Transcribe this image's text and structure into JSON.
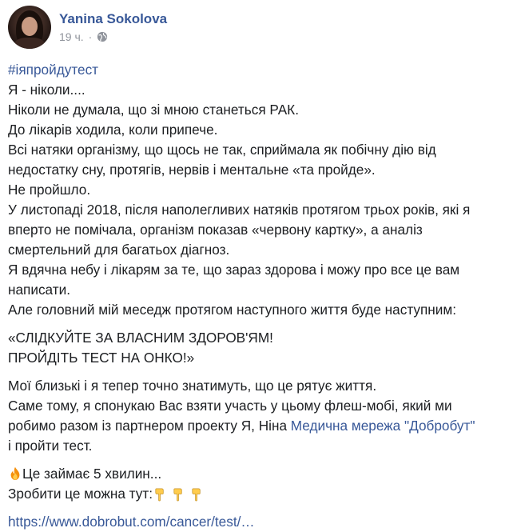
{
  "post": {
    "author": "Yanina Sokolova",
    "time": "19 ч.",
    "separator": "·",
    "hashtag": "#іяпройдутест",
    "lines1": [
      "Я - ніколи....",
      "Ніколи не думала, що зі мною станеться РАК.",
      "До лікарів ходила, коли припече.",
      "Всі натяки організму, що щось не так, сприймала як побічну дію від",
      "недостатку сну, протягів, нервів і ментальне «та пройде».",
      "Не пройшло.",
      "У листопаді 2018, після наполегливих натяків протягом трьох років, які я",
      "вперто не помічала, організм показав «червону картку», а аналіз",
      "смертельний для багатьох діагноз.",
      "Я вдячна небу і лікарям за те, що зараз здорова і можу про все це вам",
      "написати.",
      "Але головний мій меседж протягом наступного життя буде наступним:"
    ],
    "quote": [
      "«СЛІДКУЙТЕ ЗА ВЛАСНИМ ЗДОРОВ'ЯМ!",
      "ПРОЙДІТЬ ТЕСТ НА ОНКО!»"
    ],
    "lines2": [
      "Мої близькі і я тепер точно знатимуть, що це рятує життя.",
      "Саме тому, я спонукаю Вас взяти участь у цьому флеш-мобі, який ми"
    ],
    "partner_prefix": "робимо разом із партнером проекту Я, Ніна ",
    "partner_link": "Медична мережа \"Добробут\"",
    "partner_suffix": "і пройти тест.",
    "takes": "Це займає 5 хвилин...",
    "where": "Зробити це можна тут:",
    "url": "https://www.dobrobut.com/cancer/test/…",
    "icons": {
      "privacy": "globe-icon",
      "fire": "fire-emoji-icon",
      "pointing": "pointing-down-emoji-icon"
    },
    "colors": {
      "link": "#385898",
      "text": "#1c1e21",
      "meta": "#90949c"
    }
  }
}
